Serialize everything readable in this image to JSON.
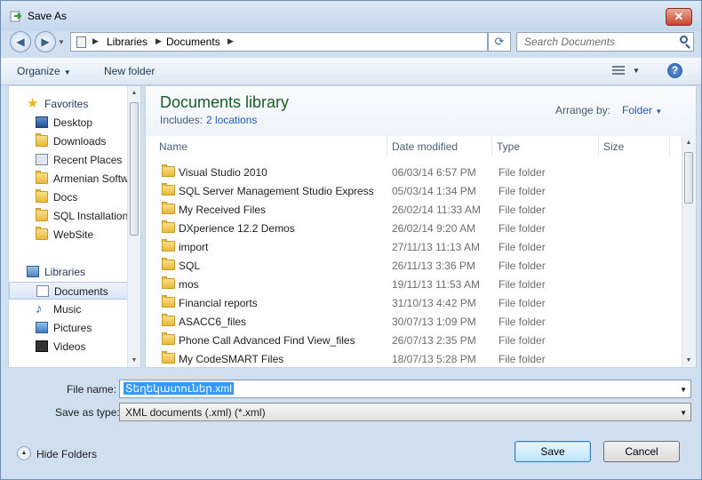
{
  "window": {
    "title": "Save As",
    "close_label": "✕"
  },
  "address": {
    "crumbs": [
      "Libraries",
      "Documents"
    ],
    "search_placeholder": "Search Documents"
  },
  "toolbar": {
    "organize": "Organize",
    "new_folder": "New folder"
  },
  "sidebar": {
    "items": [
      {
        "label": "Favorites",
        "icon": "star-icon",
        "group": true
      },
      {
        "label": "Desktop",
        "icon": "desktop-icon"
      },
      {
        "label": "Downloads",
        "icon": "downloads-folder-icon"
      },
      {
        "label": "Recent Places",
        "icon": "recent-places-icon"
      },
      {
        "label": "Armenian Software",
        "icon": "folder-icon"
      },
      {
        "label": "Docs",
        "icon": "folder-icon"
      },
      {
        "label": "SQL Installation",
        "icon": "folder-icon"
      },
      {
        "label": "WebSite",
        "icon": "folder-icon"
      },
      {
        "label": "Libraries",
        "icon": "libraries-icon",
        "group": true
      },
      {
        "label": "Documents",
        "icon": "documents-icon",
        "selected": true
      },
      {
        "label": "Music",
        "icon": "music-icon"
      },
      {
        "label": "Pictures",
        "icon": "pictures-icon"
      },
      {
        "label": "Videos",
        "icon": "videos-icon"
      }
    ]
  },
  "library": {
    "title": "Documents library",
    "includes_label": "Includes:",
    "includes_link": "2 locations",
    "arrange_label": "Arrange by:",
    "arrange_value": "Folder"
  },
  "columns": [
    "Name",
    "Date modified",
    "Type",
    "Size"
  ],
  "files": [
    {
      "name": "Visual Studio 2010",
      "date": "06/03/14 6:57 PM",
      "type": "File folder"
    },
    {
      "name": "SQL Server Management Studio Express",
      "date": "05/03/14 1:34 PM",
      "type": "File folder"
    },
    {
      "name": "My Received Files",
      "date": "26/02/14 11:33 AM",
      "type": "File folder"
    },
    {
      "name": "DXperience 12.2 Demos",
      "date": "26/02/14 9:20 AM",
      "type": "File folder"
    },
    {
      "name": "import",
      "date": "27/11/13 11:13 AM",
      "type": "File folder"
    },
    {
      "name": "SQL",
      "date": "26/11/13 3:36 PM",
      "type": "File folder"
    },
    {
      "name": "mos",
      "date": "19/11/13 11:53 AM",
      "type": "File folder"
    },
    {
      "name": "Financial reports",
      "date": "31/10/13 4:42 PM",
      "type": "File folder"
    },
    {
      "name": "ASACC6_files",
      "date": "30/07/13 1:09 PM",
      "type": "File folder"
    },
    {
      "name": "Phone Call Advanced Find View_files",
      "date": "26/07/13 2:35 PM",
      "type": "File folder"
    },
    {
      "name": "My CodeSMART Files",
      "date": "18/07/13 5:28 PM",
      "type": "File folder"
    }
  ],
  "form": {
    "filename_label": "File name:",
    "filename_value": "Տեղեկատուներ.xml",
    "savetype_label": "Save as type:",
    "savetype_value": "XML documents (.xml) (*.xml)"
  },
  "footer": {
    "hide_folders": "Hide Folders",
    "save": "Save",
    "cancel": "Cancel"
  }
}
